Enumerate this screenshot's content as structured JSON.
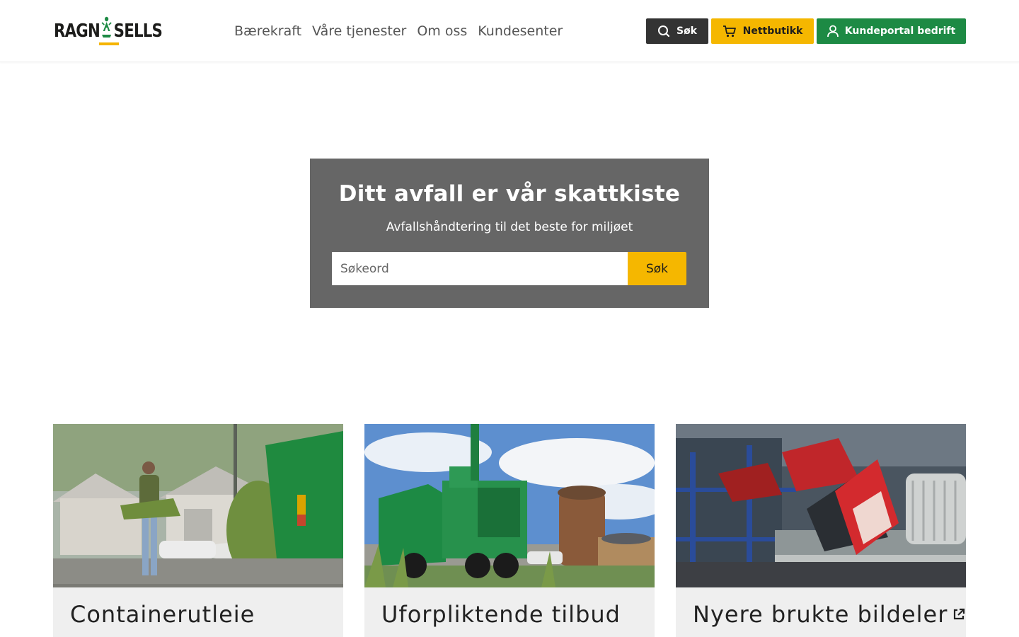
{
  "brand": {
    "name_left": "RAGN",
    "name_right": "SELLS",
    "accent": "#f5b400"
  },
  "nav": {
    "items": [
      {
        "label": "Bærekraft"
      },
      {
        "label": "Våre tjenester"
      },
      {
        "label": "Om oss"
      },
      {
        "label": "Kundesenter"
      }
    ]
  },
  "header_buttons": {
    "search": {
      "label": "Søk",
      "icon": "search-icon",
      "color": "#333333"
    },
    "shop": {
      "label": "Nettbutikk",
      "icon": "cart-icon",
      "color": "#f5b700"
    },
    "portal": {
      "label": "Kundeportal bedrift",
      "icon": "user-icon",
      "color": "#1d8a44"
    }
  },
  "hero": {
    "title": "Ditt avfall er vår skattkiste",
    "subtitle": "Avfallshåndtering til det beste for miljøet",
    "search_placeholder": "Søkeord",
    "search_value": "",
    "submit_label": "Søk",
    "background": "#666666"
  },
  "cards": [
    {
      "title": "Containerutleie",
      "external": false,
      "image": "person-carrying-branches-to-green-container"
    },
    {
      "title": "Uforpliktende tilbud",
      "external": false,
      "image": "green-garbage-truck-emptying-bin"
    },
    {
      "title": "Nyere brukte bildeler",
      "external": true,
      "image": "used-car-tail-lights-on-shelves"
    }
  ]
}
